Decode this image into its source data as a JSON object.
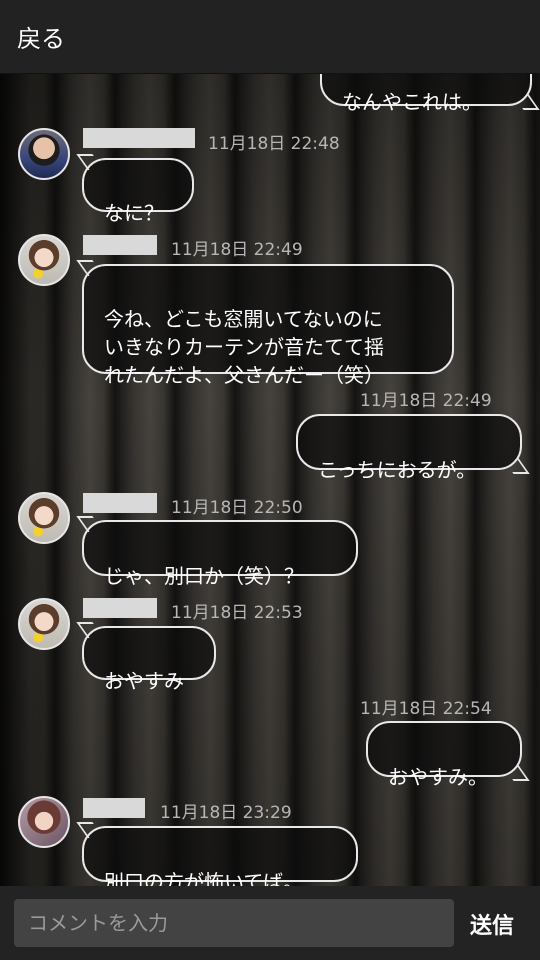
{
  "header": {
    "back_label": "戻る"
  },
  "messages": [
    {
      "side": "right",
      "text": "なんやこれは。"
    },
    {
      "side": "left",
      "timestamp": "11月18日 22:48",
      "text": "なに？"
    },
    {
      "side": "left",
      "timestamp": "11月18日 22:49",
      "text": "今ね、どこも窓開いてないのに\nいきなりカーテンが音たてて揺\nれたんだよ、父さんだー（笑）"
    },
    {
      "side": "right",
      "timestamp": "11月18日 22:49",
      "text": "こっちにおるが。"
    },
    {
      "side": "left",
      "timestamp": "11月18日 22:50",
      "text": "じゃ、別口か（笑）？"
    },
    {
      "side": "left",
      "timestamp": "11月18日 22:53",
      "text": "おやすみ"
    },
    {
      "side": "right",
      "timestamp": "11月18日 22:54",
      "text": "おやすみ。"
    },
    {
      "side": "left",
      "timestamp": "11月18日 23:29",
      "text": "別口の方が怖いてば。"
    }
  ],
  "input": {
    "placeholder": "コメントを入力",
    "value": ""
  },
  "send_label": "送信",
  "colors": {
    "bubble_border": "#e8e8e8",
    "header_bg": "#222222",
    "input_bg": "#434343"
  }
}
